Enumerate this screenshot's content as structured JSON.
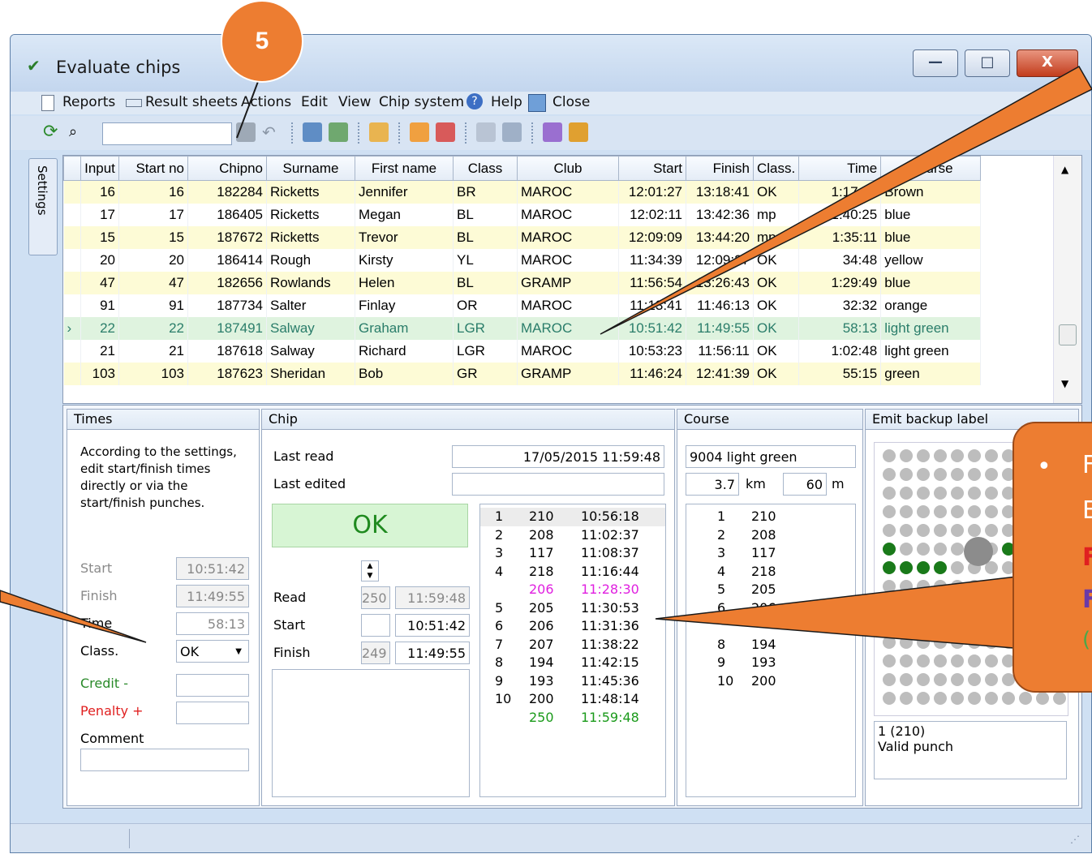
{
  "window": {
    "title": "Evaluate chips",
    "minimize": "—",
    "maximize": "□",
    "close": "X"
  },
  "menu": {
    "items": [
      "Reports",
      "Result sheets",
      "Actions",
      "Edit",
      "View",
      "Chip system",
      "Help",
      "Close"
    ]
  },
  "callout": {
    "number": "5"
  },
  "settings_tab": "Settings",
  "grid": {
    "columns": [
      "Input",
      "Start no",
      "Chipno",
      "Surname",
      "First name",
      "Class",
      "Club",
      "Start",
      "Finish",
      "Class.",
      "Time",
      "Course"
    ],
    "rows": [
      [
        "16",
        "16",
        "182284",
        "Ricketts",
        "Jennifer",
        "BR",
        "MAROC",
        "12:01:27",
        "13:18:41",
        "OK",
        "1:17:14",
        "Brown"
      ],
      [
        "17",
        "17",
        "186405",
        "Ricketts",
        "Megan",
        "BL",
        "MAROC",
        "12:02:11",
        "13:42:36",
        "mp",
        "1:40:25",
        "blue"
      ],
      [
        "15",
        "15",
        "187672",
        "Ricketts",
        "Trevor",
        "BL",
        "MAROC",
        "12:09:09",
        "13:44:20",
        "mp",
        "1:35:11",
        "blue"
      ],
      [
        "20",
        "20",
        "186414",
        "Rough",
        "Kirsty",
        "YL",
        "MAROC",
        "11:34:39",
        "12:09:27",
        "OK",
        "34:48",
        "yellow"
      ],
      [
        "47",
        "47",
        "182656",
        "Rowlands",
        "Helen",
        "BL",
        "GRAMP",
        "11:56:54",
        "13:26:43",
        "OK",
        "1:29:49",
        "blue"
      ],
      [
        "91",
        "91",
        "187734",
        "Salter",
        "Finlay",
        "OR",
        "MAROC",
        "11:13:41",
        "11:46:13",
        "OK",
        "32:32",
        "orange"
      ],
      [
        "22",
        "22",
        "187491",
        "Salway",
        "Graham",
        "LGR",
        "MAROC",
        "10:51:42",
        "11:49:55",
        "OK",
        "58:13",
        "light green"
      ],
      [
        "21",
        "21",
        "187618",
        "Salway",
        "Richard",
        "LGR",
        "MAROC",
        "10:53:23",
        "11:56:11",
        "OK",
        "1:02:48",
        "light green"
      ],
      [
        "103",
        "103",
        "187623",
        "Sheridan",
        "Bob",
        "GR",
        "GRAMP",
        "11:46:24",
        "12:41:39",
        "OK",
        "55:15",
        "green"
      ]
    ]
  },
  "times_panel": {
    "header": "Times",
    "description": "According to the settings, edit start/finish times directly or via the start/finish punches.",
    "start_label": "Start",
    "start_value": "10:51:42",
    "finish_label": "Finish",
    "finish_value": "11:49:55",
    "time_label": "Time",
    "time_value": "58:13",
    "class_label": "Class.",
    "class_value": "OK",
    "credit_label": "Credit -",
    "penalty_label": "Penalty +",
    "comment_label": "Comment"
  },
  "chip_panel": {
    "header": "Chip",
    "last_read_label": "Last read",
    "last_read_value": "17/05/2015 11:59:48",
    "last_edited_label": "Last edited",
    "status": "OK",
    "read_label": "Read",
    "read_code": "250",
    "read_time": "11:59:48",
    "start_label": "Start",
    "start_time": "10:51:42",
    "finish_label": "Finish",
    "finish_code": "249",
    "finish_time": "11:49:55",
    "punches": [
      {
        "n": "1",
        "code": "210",
        "time": "10:56:18",
        "color": "#000000"
      },
      {
        "n": "2",
        "code": "208",
        "time": "11:02:37",
        "color": "#000000"
      },
      {
        "n": "3",
        "code": "117",
        "time": "11:08:37",
        "color": "#000000"
      },
      {
        "n": "4",
        "code": "218",
        "time": "11:16:44",
        "color": "#000000"
      },
      {
        "n": "",
        "code": "206",
        "time": "11:28:30",
        "color": "#e020e0"
      },
      {
        "n": "5",
        "code": "205",
        "time": "11:30:53",
        "color": "#000000"
      },
      {
        "n": "6",
        "code": "206",
        "time": "11:31:36",
        "color": "#000000"
      },
      {
        "n": "7",
        "code": "207",
        "time": "11:38:22",
        "color": "#000000"
      },
      {
        "n": "8",
        "code": "194",
        "time": "11:42:15",
        "color": "#000000"
      },
      {
        "n": "9",
        "code": "193",
        "time": "11:45:36",
        "color": "#000000"
      },
      {
        "n": "10",
        "code": "200",
        "time": "11:48:14",
        "color": "#000000"
      },
      {
        "n": "",
        "code": "250",
        "time": "11:59:48",
        "color": "#1a9a1a"
      }
    ]
  },
  "course_panel": {
    "header": "Course",
    "name": "9004 light green",
    "length": "3.7",
    "length_unit": "km",
    "climb": "60",
    "climb_unit": "m",
    "controls": [
      {
        "n": "1",
        "code": "210"
      },
      {
        "n": "2",
        "code": "208"
      },
      {
        "n": "3",
        "code": "117"
      },
      {
        "n": "4",
        "code": "218"
      },
      {
        "n": "5",
        "code": "205"
      },
      {
        "n": "6",
        "code": "206"
      },
      {
        "n": "",
        "code": ""
      },
      {
        "n": "8",
        "code": "194"
      },
      {
        "n": "9",
        "code": "193"
      },
      {
        "n": "10",
        "code": "200"
      }
    ]
  },
  "emit_panel": {
    "header": "Emit backup label",
    "info_line1": "1 (210)",
    "info_line2": "Valid punch"
  },
  "overlay_text": {
    "bullet": "•",
    "lines": [
      "F",
      "E",
      "F",
      "F",
      "("
    ]
  }
}
